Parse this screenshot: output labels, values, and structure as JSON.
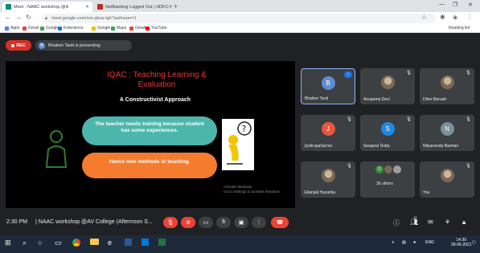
{
  "browser": {
    "tabs": [
      {
        "label": "Meet - NAAC workshop @A",
        "active": true
      },
      {
        "label": "NetBanking Logged Out | HDFC",
        "active": false
      }
    ],
    "url": "meet.google.com/xxx-gkus-tgh?authuser=1",
    "bookmarks": [
      "Apps",
      "Gmail",
      "Google",
      "Extensions",
      "Google",
      "Maps",
      "Gmail",
      "YouTube"
    ],
    "reading_list": "Reading list"
  },
  "meet": {
    "rec_label": "REC",
    "presenting_initial": "B",
    "presenting_text": "Bhaben Tanti is presenting",
    "clock": "2:30 PM",
    "meeting_title": "NAAC workshop @AV College (Afternoon S...",
    "participant_count": "18"
  },
  "slide": {
    "title": "IQAC : Teaching Learning & Evaluation",
    "subtitle": "A Constructivist Approach",
    "box1": "The teacher needs training because student has some experiences.",
    "box2": "Hence new methods of teacking.",
    "watermark_line1": "Activate Windows",
    "watermark_line2": "Go to Settings to activate Windows."
  },
  "participants": [
    {
      "name": "Bhaben Tanti",
      "initial": "B",
      "color": "#5f8dd3",
      "type": "avatar"
    },
    {
      "name": "Anupama Devi",
      "type": "photo"
    },
    {
      "name": "Ditee Baruah",
      "type": "photo"
    },
    {
      "name": "JyotirupaSarma",
      "initial": "J",
      "color": "#e8563f",
      "type": "avatar"
    },
    {
      "name": "Swapnal Dutta",
      "initial": "S",
      "color": "#1e88e5",
      "type": "avatar"
    },
    {
      "name": "Nityananda Barman",
      "initial": "N",
      "color": "#78909c",
      "type": "avatar"
    },
    {
      "name": "Gitanjali Hazarika",
      "type": "photo"
    },
    {
      "name": "36 others",
      "type": "others",
      "initials": [
        "D",
        "",
        ""
      ]
    },
    {
      "name": "You",
      "type": "photo"
    }
  ],
  "taskbar": {
    "lang": "ENG",
    "time": "14:30",
    "date": "28-06-2021"
  }
}
